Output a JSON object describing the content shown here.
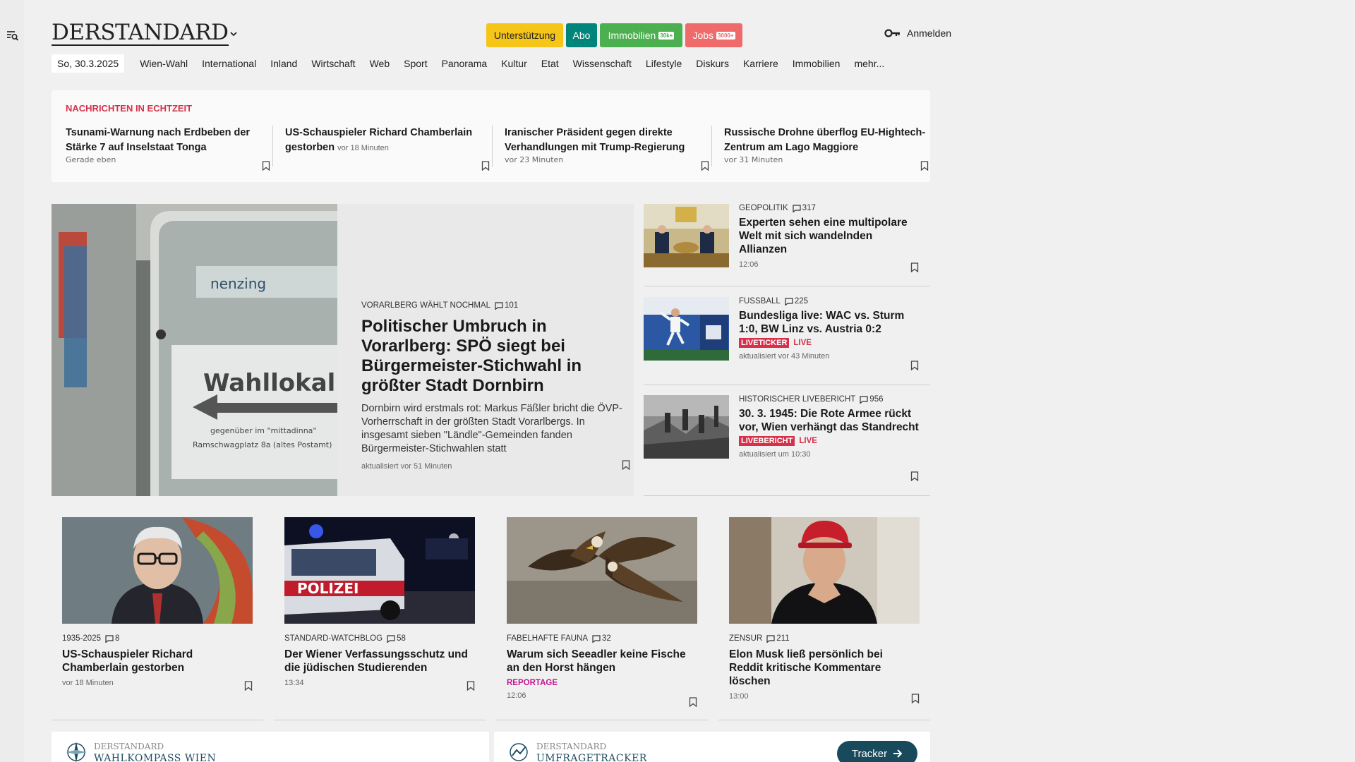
{
  "header": {
    "logo": "DERSTANDARD",
    "pills": {
      "support": "Unterstützung",
      "abo": "Abo",
      "immobilien": "Immobilien",
      "immobilien_count": "30k+",
      "jobs": "Jobs",
      "jobs_count": "3000+"
    },
    "login": "Anmelden"
  },
  "nav": {
    "date": "So, 30.3.2025",
    "items": [
      "Wien-Wahl",
      "International",
      "Inland",
      "Wirtschaft",
      "Web",
      "Sport",
      "Panorama",
      "Kultur",
      "Etat",
      "Wissenschaft",
      "Lifestyle",
      "Diskurs",
      "Karriere",
      "Immobilien",
      "mehr..."
    ]
  },
  "live_news": {
    "title": "NACHRICHTEN IN ECHTZEIT",
    "items": [
      {
        "headline": "Tsunami-Warnung nach Erdbeben der Stärke 7 auf Inselstaat Tonga",
        "time": "Gerade eben"
      },
      {
        "headline": "US-Schauspieler Richard Chamberlain gestorben",
        "time": "vor 18 Minuten"
      },
      {
        "headline": "Iranischer Präsident gegen direkte Verhandlungen mit Trump-Regierung",
        "time": "vor 23 Minuten"
      },
      {
        "headline": "Russische Drohne überflog EU-Hightech-Zentrum am Lago Maggiore",
        "time": "vor 31 Minuten"
      }
    ]
  },
  "hero": {
    "kicker": "VORARLBERG WÄHLT NOCHMAL",
    "comments": "101",
    "title": "Politischer Umbruch in Vorarlberg: SPÖ siegt bei Bürgermeister-Stichwahl in größter Stadt Dornbirn",
    "teaser": "Dornbirn wird erstmals rot: Markus Fäßler bricht die ÖVP-Vorherrschaft in der größten Stadt Vorarlbergs. In insgesamt sieben \"Ländle\"-Gemeinden fanden Bürgermeister-Stichwahlen statt",
    "time": "aktualisiert vor 51 Minuten",
    "image_text": {
      "sign_top": "nenzing",
      "sign_main": "Wahllokal",
      "sign_line1": "gegenüber im \"mittadinna\"",
      "sign_line2": "Ramschwagplatz 8a (altes Postamt)"
    }
  },
  "side": [
    {
      "kicker": "GEOPOLITIK",
      "comments": "317",
      "title": "Experten sehen eine multipolare Welt mit sich wandelnden Allianzen",
      "meta": "12:06"
    },
    {
      "kicker": "FUSSBALL",
      "comments": "225",
      "title": "Bundesliga live: WAC vs. Sturm 1:0, BW Linz vs. Austria 0:2",
      "tag": "LIVETICKER",
      "live": "LIVE",
      "meta": "aktualisiert vor 43 Minuten"
    },
    {
      "kicker": "HISTORISCHER LIVEBERICHT",
      "comments": "956",
      "title": "30. 3. 1945: Die Rote Armee rückt vor, Wien verhängt das Standrecht",
      "tag": "LIVEBERICHT",
      "live": "LIVE",
      "meta": "aktualisiert um 10:30"
    }
  ],
  "cards": [
    {
      "kicker": "1935-2025",
      "comments": "8",
      "title": "US-Schauspieler Richard Chamberlain gestorben",
      "meta": "vor 18 Minuten"
    },
    {
      "kicker": "STANDARD-WATCHBLOG",
      "comments": "58",
      "title": "Der Wiener Verfassungsschutz und die jüdischen Studierenden",
      "meta": "13:34",
      "image_text": "POLIZEI"
    },
    {
      "kicker": "FABELHAFTE FAUNA",
      "comments": "32",
      "title": "Warum sich Seeadler keine Fische an den Horst hängen",
      "reportage": "REPORTAGE",
      "meta": "12:06"
    },
    {
      "kicker": "ZENSUR",
      "comments": "211",
      "title": "Elon Musk ließ persönlich bei Reddit kritische Kommentare löschen",
      "meta": "13:00"
    }
  ],
  "promos": [
    {
      "brand": "DERSTANDARD",
      "name": "WAHLKOMPASS WIEN"
    },
    {
      "brand": "DERSTANDARD",
      "name": "UMFRAGETRACKER",
      "button": "Tracker"
    }
  ],
  "colors": {
    "live_red": "#d6304a",
    "support_yellow": "#f5c518",
    "abo_teal": "#00857a",
    "immobilien_green": "#4caf50",
    "jobs_red": "#ef6b6b",
    "reportage_magenta": "#c4168f",
    "tracker_button": "#184a5c"
  }
}
